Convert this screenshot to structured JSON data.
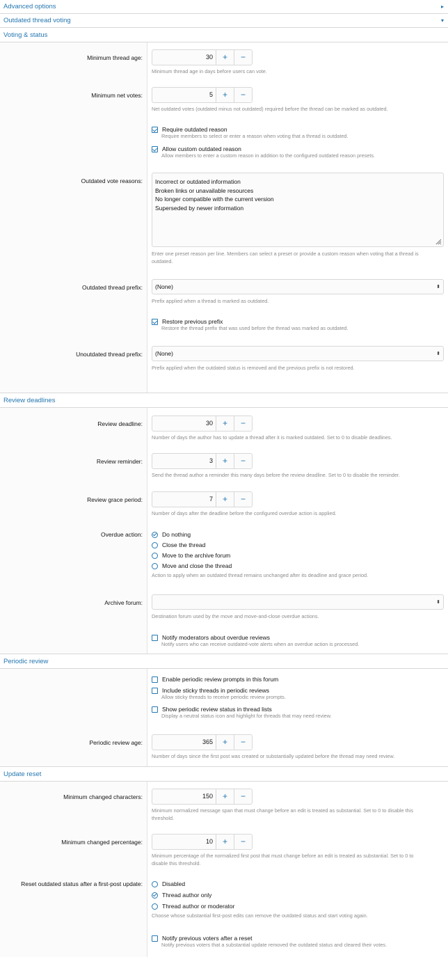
{
  "collapsed_sections": [
    {
      "title": "Advanced options",
      "chevron": "▸"
    },
    {
      "title": "Outdated thread voting",
      "chevron": "▾"
    }
  ],
  "voting": {
    "title": "Voting & status",
    "min_age": {
      "label": "Minimum thread age:",
      "value": "30",
      "hint": "Minimum thread age in days before users can vote."
    },
    "min_votes": {
      "label": "Minimum net votes:",
      "value": "5",
      "hint": "Net outdated votes (outdated minus not outdated) required before the thread can be marked as outdated."
    },
    "require_reason": {
      "label": "Require outdated reason",
      "hint": "Require members to select or enter a reason when voting that a thread is outdated."
    },
    "allow_custom": {
      "label": "Allow custom outdated reason",
      "hint": "Allow members to enter a custom reason in addition to the configured outdated reason presets."
    },
    "reasons": {
      "label": "Outdated vote reasons:",
      "lines": [
        "Incorrect or outdated information",
        "Broken links or unavailable resources",
        "No longer compatible with the current version",
        "Superseded by newer information"
      ],
      "hint1": "Enter one preset reason per line. Members can select a preset or provide a custom reason when voting that a thread is",
      "hint2": "outdated."
    },
    "prefix": {
      "label": "Outdated thread prefix:",
      "value": "(None)",
      "hint": "Prefix applied when a thread is marked as outdated."
    },
    "restore": {
      "label": "Restore previous prefix",
      "hint": "Restore the thread prefix that was used before the thread was marked as outdated."
    },
    "unprefix": {
      "label": "Unoutdated thread prefix:",
      "value": "(None)",
      "hint": "Prefix applied when the outdated status is removed and the previous prefix is not restored."
    }
  },
  "deadlines": {
    "title": "Review deadlines",
    "deadline": {
      "label": "Review deadline:",
      "value": "30",
      "hint": "Number of days the author has to update a thread after it is marked outdated. Set to 0 to disable deadlines."
    },
    "reminder": {
      "label": "Review reminder:",
      "value": "3",
      "hint": "Send the thread author a reminder this many days before the review deadline. Set to 0 to disable the reminder."
    },
    "grace": {
      "label": "Review grace period:",
      "value": "7",
      "hint": "Number of days after the deadline before the configured overdue action is applied."
    },
    "overdue": {
      "label": "Overdue action:",
      "options": [
        "Do nothing",
        "Close the thread",
        "Move to the archive forum",
        "Move and close the thread"
      ],
      "hint": "Action to apply when an outdated thread remains unchanged after its deadline and grace period."
    },
    "archive": {
      "label": "Archive forum:",
      "value": "",
      "hint": "Destination forum used by the move and move-and-close overdue actions."
    },
    "notify_mods": {
      "label": "Notify moderators about overdue reviews",
      "hint": "Notify users who can receive outdated-vote alerts when an overdue action is processed."
    }
  },
  "periodic": {
    "title": "Periodic review",
    "enable": {
      "label": "Enable periodic review prompts in this forum"
    },
    "sticky": {
      "label": "Include sticky threads in periodic reviews",
      "hint": "Allow sticky threads to receive periodic review prompts."
    },
    "status": {
      "label": "Show periodic review status in thread lists",
      "hint": "Display a neutral status icon and highlight for threads that may need review."
    },
    "age": {
      "label": "Periodic review age:",
      "value": "365",
      "hint": "Number of days since the first post was created or substantially updated before the thread may need review."
    }
  },
  "reset": {
    "title": "Update reset",
    "chars": {
      "label": "Minimum changed characters:",
      "value": "150",
      "hint1": "Minimum normalized message span that must change before an edit is treated as substantial. Set to 0 to disable this",
      "hint2": "threshold."
    },
    "pct": {
      "label": "Minimum changed percentage:",
      "value": "10",
      "hint1": "Minimum percentage of the normalized first post that must change before an edit is treated as substantial. Set to 0 to",
      "hint2": "disable this threshold."
    },
    "after": {
      "label": "Reset outdated status after a first-post update:",
      "options": [
        "Disabled",
        "Thread author only",
        "Thread author or moderator"
      ],
      "hint": "Choose whose substantial first-post edits can remove the outdated status and start voting again."
    },
    "notify_voters": {
      "label": "Notify previous voters after a reset",
      "hint": "Notify previous voters that a substantial update removed the outdated status and cleared their votes."
    }
  },
  "stepper": {
    "plus": "+",
    "minus": "−"
  },
  "select_arrow": "⬍"
}
